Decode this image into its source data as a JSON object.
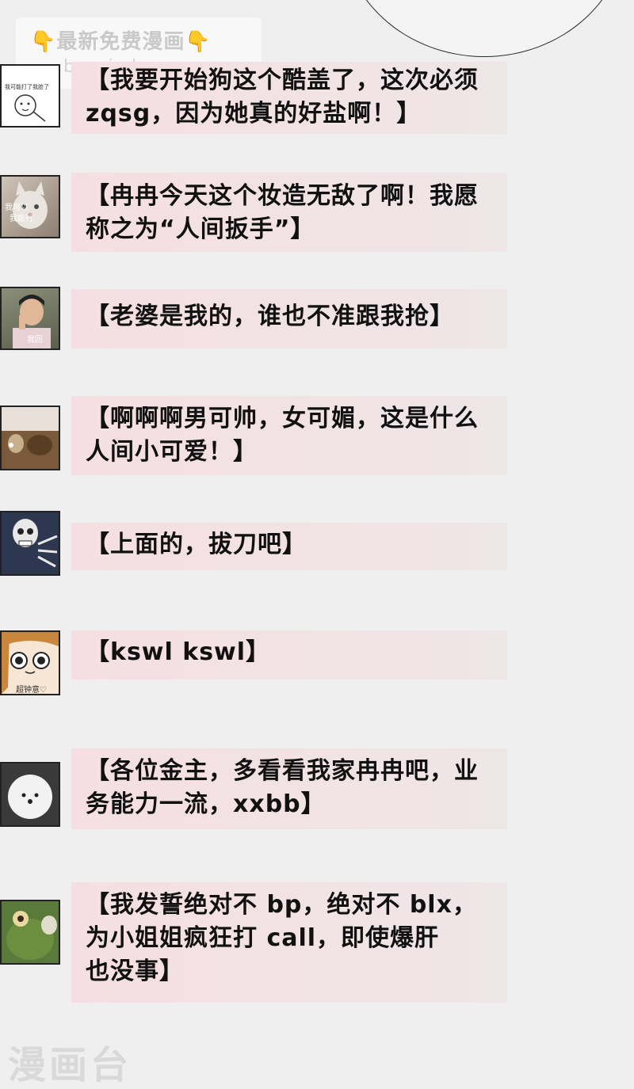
{
  "watermark": {
    "line1": "最新免费漫画",
    "line2": "baozimh.com",
    "hand_left": "👇",
    "hand_right": "👇"
  },
  "avatar_captions": {
    "a1": "我可能打了我脸了",
    "a2": "我可以",
    "a2b": "我能行",
    "a3": "我回",
    "a6": "超钟意♡"
  },
  "comments": [
    {
      "text": "【我要开始狗这个酷盖了，这次必须\nzqsg，因为她真的好盐啊！】",
      "avatar_icon": "cartoon-face-icon"
    },
    {
      "text": "【冉冉今天这个妆造无敌了啊！我愿\n称之为“人间扳手”】",
      "avatar_icon": "cat-icon"
    },
    {
      "text": "【老婆是我的，谁也不准跟我抢】",
      "avatar_icon": "pointing-man-icon"
    },
    {
      "text": "【啊啊啊男可帅，女可媚，这是什么\n人间小可爱！】",
      "avatar_icon": "dog-icon"
    },
    {
      "text": "【上面的，拔刀吧】",
      "avatar_icon": "skeleton-icon"
    },
    {
      "text": "【kswl kswl】",
      "avatar_icon": "anime-girl-icon"
    },
    {
      "text": "【各位金主，多看看我家冉冉吧，业\n务能力一流，xxbb】",
      "avatar_icon": "fluffy-dog-icon"
    },
    {
      "text": "【我发誓绝对不 bp，绝对不 blx，\n为小姐姐疯狂打 call，即使爆肝\n也没事】",
      "avatar_icon": "frog-icon"
    }
  ],
  "footer": {
    "logo": "漫画台"
  },
  "colors": {
    "bubble": "#f5dfe2",
    "background": "#efefef",
    "text": "#111111"
  }
}
